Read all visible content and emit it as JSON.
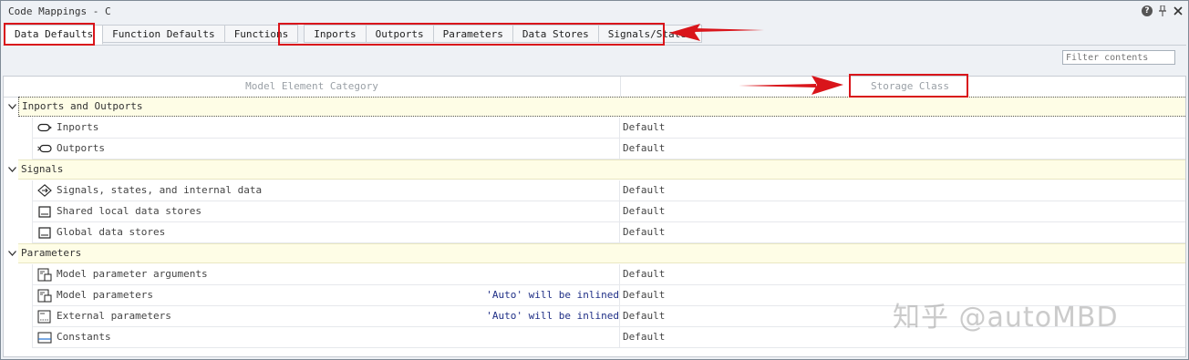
{
  "window": {
    "title": "Code Mappings - C",
    "buttons": [
      "help-icon",
      "pin-icon",
      "close-icon"
    ]
  },
  "tabs": [
    {
      "label": "Data Defaults",
      "active": true
    },
    {
      "label": "Function Defaults",
      "active": false
    },
    {
      "label": "Functions",
      "active": false
    },
    {
      "label": "Inports",
      "active": false
    },
    {
      "label": "Outports",
      "active": false
    },
    {
      "label": "Parameters",
      "active": false
    },
    {
      "label": "Data Stores",
      "active": false
    },
    {
      "label": "Signals/States",
      "active": false
    }
  ],
  "filter": {
    "placeholder": "Filter contents",
    "value": ""
  },
  "table": {
    "columns": [
      "Model Element Category",
      "Storage Class"
    ],
    "groups": [
      {
        "label": "Inports and Outports",
        "items": [
          {
            "icon": "inport-icon",
            "label": "Inports",
            "note": "",
            "storage": "Default"
          },
          {
            "icon": "outport-icon",
            "label": "Outports",
            "note": "",
            "storage": "Default"
          }
        ]
      },
      {
        "label": "Signals",
        "items": [
          {
            "icon": "signal-icon",
            "label": "Signals, states, and internal data",
            "note": "",
            "storage": "Default"
          },
          {
            "icon": "data-store-icon",
            "label": "Shared local data stores",
            "note": "",
            "storage": "Default"
          },
          {
            "icon": "data-store-icon",
            "label": "Global data stores",
            "note": "",
            "storage": "Default"
          }
        ]
      },
      {
        "label": "Parameters",
        "items": [
          {
            "icon": "parameter-icon",
            "label": "Model parameter arguments",
            "note": "",
            "storage": "Default"
          },
          {
            "icon": "parameter-icon",
            "label": "Model parameters",
            "note": "'Auto' will be inlined",
            "storage": "Default"
          },
          {
            "icon": "external-parameter-icon",
            "label": "External parameters",
            "note": "'Auto' will be inlined",
            "storage": "Default"
          },
          {
            "icon": "constant-icon",
            "label": "Constants",
            "note": "",
            "storage": "Default"
          }
        ]
      }
    ]
  },
  "watermark": "知乎 @autoMBD",
  "colors": {
    "highlight_red": "#d9151b",
    "group_band": "#fefde6",
    "note_blue": "#1f2f86"
  }
}
